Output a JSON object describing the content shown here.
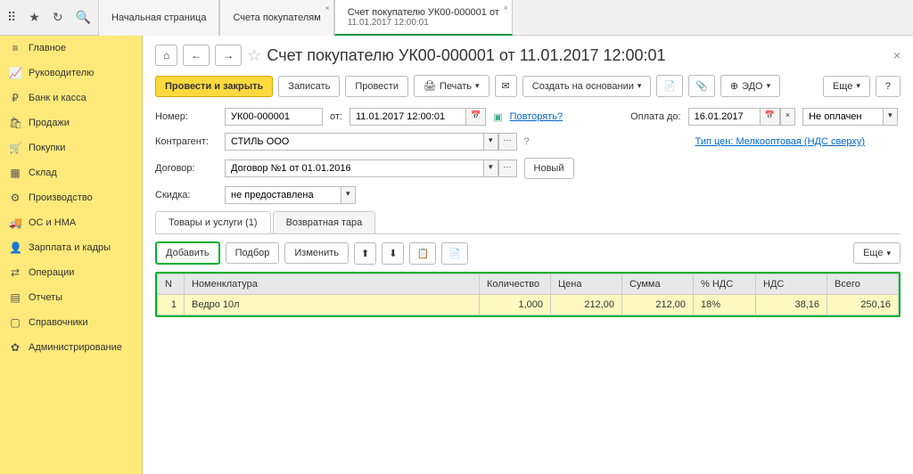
{
  "top_tabs": [
    {
      "label": "Начальная страница"
    },
    {
      "label": "Счета покупателям",
      "closable": true
    },
    {
      "label_l1": "Счет покупателю УК00-000001 от",
      "label_l2": "11.01.2017 12:00:01",
      "closable": true,
      "active": true
    }
  ],
  "sidebar": {
    "items": [
      {
        "icon": "≡",
        "label": "Главное"
      },
      {
        "icon": "📈",
        "label": "Руководителю"
      },
      {
        "icon": "₽",
        "label": "Банк и касса"
      },
      {
        "icon": "🛍",
        "label": "Продажи"
      },
      {
        "icon": "🛒",
        "label": "Покупки"
      },
      {
        "icon": "▦",
        "label": "Склад"
      },
      {
        "icon": "⚙",
        "label": "Производство"
      },
      {
        "icon": "🚚",
        "label": "ОС и НМА"
      },
      {
        "icon": "👤",
        "label": "Зарплата и кадры"
      },
      {
        "icon": "⇄",
        "label": "Операции"
      },
      {
        "icon": "▤",
        "label": "Отчеты"
      },
      {
        "icon": "▢",
        "label": "Справочники"
      },
      {
        "icon": "✿",
        "label": "Администрирование"
      }
    ]
  },
  "doc": {
    "title": "Счет покупателю УК00-000001 от 11.01.2017 12:00:01",
    "toolbar": {
      "post_close": "Провести и закрыть",
      "save": "Записать",
      "post": "Провести",
      "print": "Печать",
      "create_based": "Создать на основании",
      "edo": "ЭДО",
      "more": "Еще",
      "help": "?"
    },
    "fields": {
      "number_label": "Номер:",
      "number": "УК00-000001",
      "date_label": "от:",
      "date": "11.01.2017 12:00:01",
      "repeat": "Повторять?",
      "paydue_label": "Оплата до:",
      "paydue": "16.01.2017",
      "status": "Не оплачен",
      "contractor_label": "Контрагент:",
      "contractor": "СТИЛЬ ООО",
      "price_type_link": "Тип цен: Мелкооптовая (НДС сверху)",
      "contract_label": "Договор:",
      "contract": "Договор №1 от 01.01.2016",
      "new_btn": "Новый",
      "discount_label": "Скидка:",
      "discount": "не предоставлена"
    },
    "tabs": {
      "goods": "Товары и услуги (1)",
      "tare": "Возвратная тара"
    },
    "tbl_toolbar": {
      "add": "Добавить",
      "pick": "Подбор",
      "edit": "Изменить",
      "more": "Еще"
    },
    "tbl": {
      "headers": {
        "n": "N",
        "nomen": "Номенклатура",
        "qty": "Количество",
        "price": "Цена",
        "sum": "Сумма",
        "vat_pct": "% НДС",
        "vat": "НДС",
        "total": "Всего"
      },
      "row": {
        "n": "1",
        "nomen": "Ведро 10л",
        "qty": "1,000",
        "price": "212,00",
        "sum": "212,00",
        "vat_pct": "18%",
        "vat": "38,16",
        "total": "250,16"
      }
    }
  }
}
